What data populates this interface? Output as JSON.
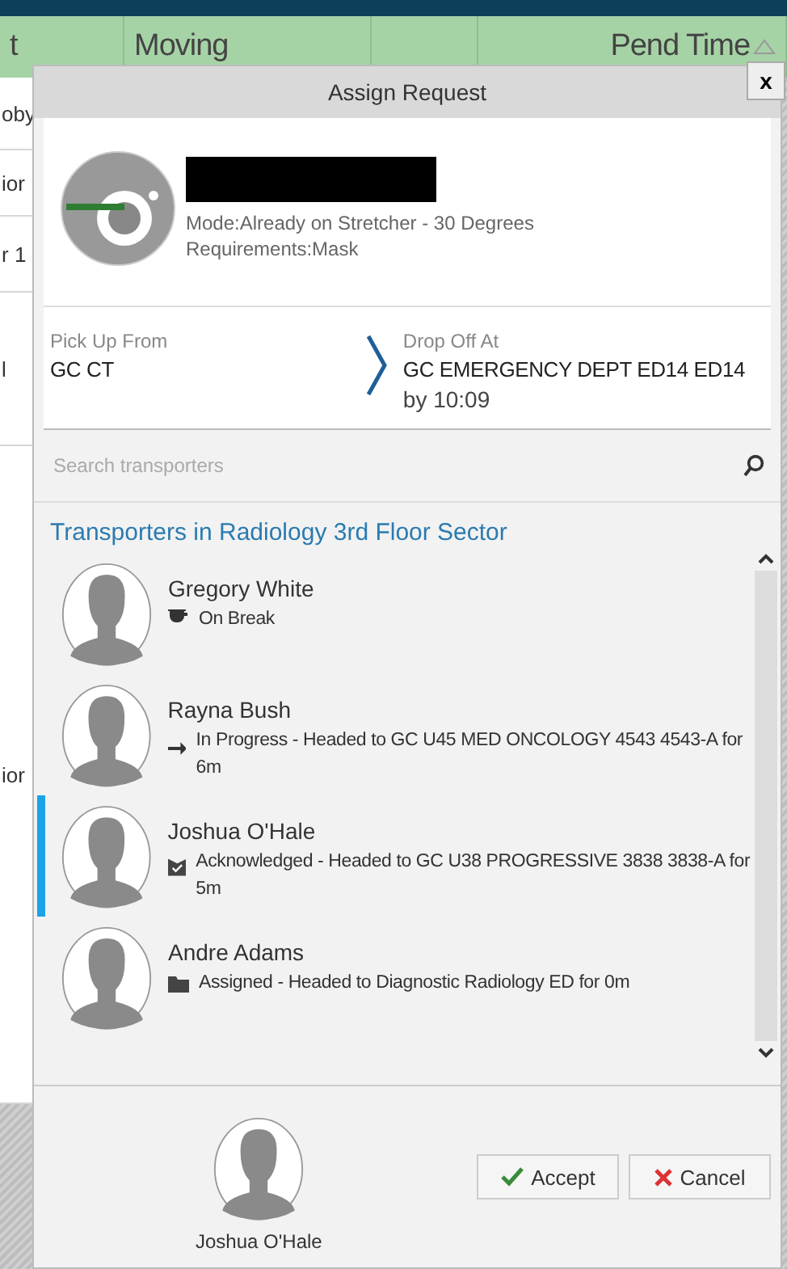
{
  "table": {
    "columns": [
      {
        "label": "t",
        "sorted": false
      },
      {
        "label": "Moving",
        "sorted": false
      },
      {
        "label": "Pend Time",
        "sorted": true
      }
    ],
    "rows": [
      "oby",
      "ior",
      "r 1",
      "l",
      "ior"
    ]
  },
  "dialog": {
    "title": "Assign Request",
    "close": "x",
    "patient": {
      "name_redacted": true,
      "mode": "Mode:Already on Stretcher - 30 Degrees",
      "requirements": "Requirements:Mask"
    },
    "pickup": {
      "label": "Pick Up From",
      "value": "GC CT"
    },
    "dropoff": {
      "label": "Drop Off At",
      "value": "GC EMERGENCY DEPT ED14 ED14",
      "by": "by 10:09"
    },
    "search": {
      "placeholder": "Search transporters"
    },
    "group": "Transporters in Radiology 3rd Floor Sector",
    "transporters": [
      {
        "name": "Gregory White",
        "kind": "break",
        "status": "On Break",
        "selected": false
      },
      {
        "name": "Rayna Bush",
        "kind": "progress",
        "status": "In Progress - Headed to GC U45 MED ONCOLOGY 4543 4543-A for 6m",
        "selected": false
      },
      {
        "name": "Joshua O'Hale",
        "kind": "acknowledged",
        "status": "Acknowledged - Headed to GC U38 PROGRESSIVE 3838 3838-A for 5m",
        "selected": true
      },
      {
        "name": "Andre Adams",
        "kind": "assigned",
        "status": "Assigned - Headed to Diagnostic Radiology ED for 0m",
        "selected": false
      }
    ],
    "assignee": {
      "name": "Joshua O'Hale"
    },
    "buttons": [
      {
        "label": "Accept",
        "kind": "accept"
      },
      {
        "label": "Cancel",
        "kind": "cancel"
      }
    ]
  }
}
